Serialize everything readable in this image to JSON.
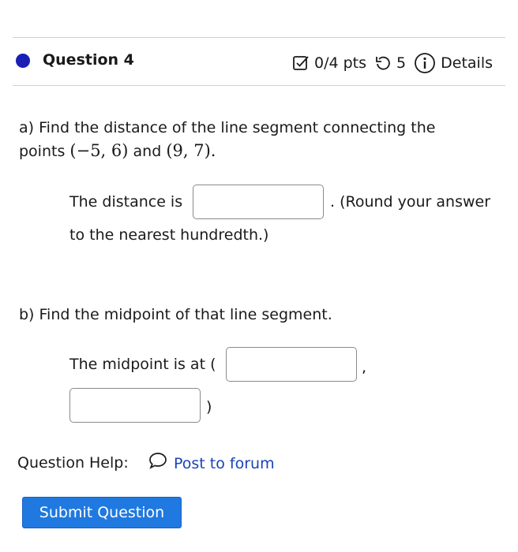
{
  "question": {
    "title": "Question 4",
    "score": "0/4 pts",
    "attempts": "5",
    "details_label": "Details",
    "status_color": "#1a1fb5"
  },
  "part_a": {
    "prompt_pre": "a) Find the distance of the line segment connecting the",
    "prompt_points_word": "points",
    "point1": "(−5, 6)",
    "and_word": "and",
    "point2": "(9, 7)",
    "period": ".",
    "distance_label": "The distance is",
    "distance_value": "",
    "round_note": ". (Round your answer",
    "round_note_2": "to the nearest hundredth.)"
  },
  "part_b": {
    "prompt": "b) Find the midpoint of that line segment.",
    "midpoint_label": "The midpoint is at (",
    "comma": ",",
    "close_paren": ")",
    "x_value": "",
    "y_value": ""
  },
  "help": {
    "label": "Question Help:",
    "forum_link": "Post to forum"
  },
  "submit_label": "Submit Question",
  "icons": [
    "checkbox-score-icon",
    "retry-icon",
    "info-icon",
    "speech-bubble-icon"
  ]
}
